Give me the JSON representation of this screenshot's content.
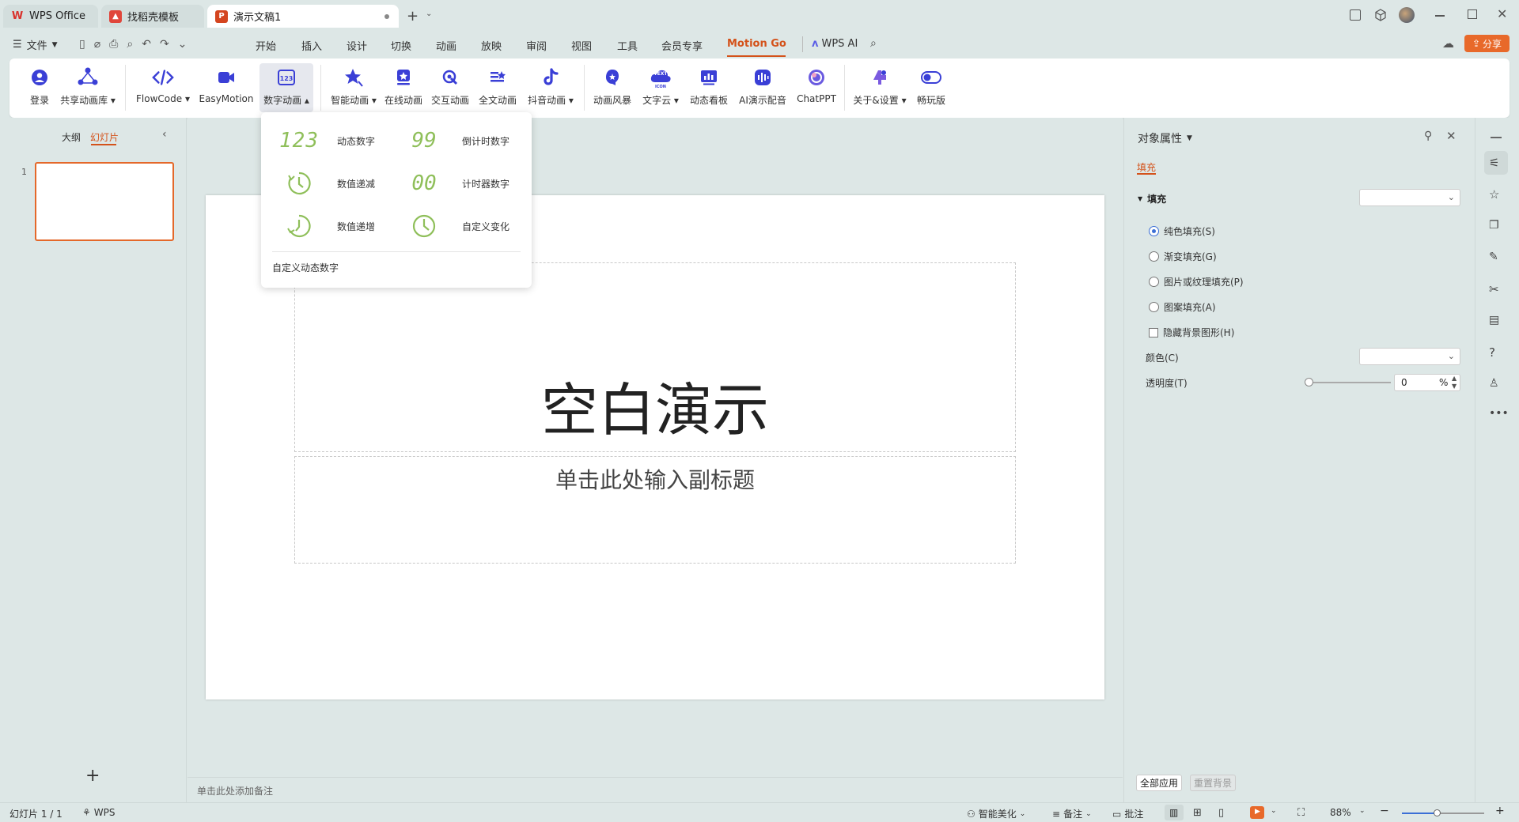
{
  "tabs": [
    {
      "label": "WPS Office",
      "icon": "wps-logo-icon"
    },
    {
      "label": "找稻壳模板",
      "icon": "docer-icon"
    },
    {
      "label": "演示文稿1",
      "icon": "presentation-icon"
    }
  ],
  "menu": {
    "file": "文件",
    "items": [
      "开始",
      "插入",
      "设计",
      "切换",
      "动画",
      "放映",
      "审阅",
      "视图",
      "工具",
      "会员专享",
      "Motion Go"
    ],
    "active": "Motion Go",
    "wps_ai": "WPS AI",
    "share": "分享"
  },
  "ribbon": {
    "buttons": [
      {
        "label": "登录",
        "icon": "user-icon"
      },
      {
        "label": "共享动画库",
        "icon": "share-library-icon",
        "dropdown": true
      },
      {
        "label": "FlowCode",
        "icon": "code-icon",
        "dropdown": true
      },
      {
        "label": "EasyMotion",
        "icon": "video-icon"
      },
      {
        "label": "数字动画",
        "icon": "number-animation-icon",
        "dropdown": true
      },
      {
        "label": "智能动画",
        "icon": "star-icon",
        "dropdown": true
      },
      {
        "label": "在线动画",
        "icon": "online-animation-icon"
      },
      {
        "label": "交互动画",
        "icon": "interactive-icon"
      },
      {
        "label": "全文动画",
        "icon": "fulltext-icon"
      },
      {
        "label": "抖音动画",
        "icon": "tiktok-icon",
        "dropdown": true
      },
      {
        "label": "动画风暴",
        "icon": "storm-icon"
      },
      {
        "label": "文字云",
        "icon": "word-cloud-icon",
        "dropdown": true
      },
      {
        "label": "动态看板",
        "icon": "dashboard-icon"
      },
      {
        "label": "AI演示配音",
        "icon": "voice-icon"
      },
      {
        "label": "ChatPPT",
        "icon": "chatppt-icon"
      },
      {
        "label": "关于&设置",
        "icon": "settings-icon",
        "dropdown": true
      },
      {
        "label": "畅玩版",
        "icon": "toggle-icon"
      }
    ],
    "wordcloud_badge_top": "TEXT",
    "wordcloud_badge_bottom": "ICON"
  },
  "dropdown": {
    "items": [
      {
        "label": "动态数字",
        "glyph": "123"
      },
      {
        "label": "倒计时数字",
        "glyph": "99"
      },
      {
        "label": "数值递减",
        "glyph": ""
      },
      {
        "label": "计时器数字",
        "glyph": "00"
      },
      {
        "label": "数值递增",
        "glyph": ""
      },
      {
        "label": "自定义变化",
        "glyph": ""
      }
    ],
    "custom": "自定义动态数字"
  },
  "leftpanel": {
    "tab_outline": "大纲",
    "tab_slides": "幻灯片",
    "slide_number": "1",
    "add": "+"
  },
  "slide": {
    "title": "空白演示",
    "subtitle": "单击此处输入副标题"
  },
  "notes": {
    "placeholder": "单击此处添加备注"
  },
  "rightpanel": {
    "title": "对象属性",
    "tab": "填充",
    "section": "填充",
    "options": [
      "纯色填充(S)",
      "渐变填充(G)",
      "图片或纹理填充(P)",
      "图案填充(A)"
    ],
    "selected_option": 0,
    "hide_bg": "隐藏背景图形(H)",
    "color_label": "颜色(C)",
    "transparency_label": "透明度(T)",
    "transparency_value": "0",
    "transparency_unit": "%",
    "apply_all": "全部应用",
    "reset_bg": "重置背景"
  },
  "status": {
    "slide_count": "幻灯片 1 / 1",
    "theme": "WPS",
    "beautify": "智能美化",
    "notes": "备注",
    "comments": "批注",
    "zoom": "88%"
  },
  "colors": {
    "accent": "#d4521a",
    "ribbon_icon": "#3a3fd6",
    "dropdown_glyph": "#8fbf5a"
  }
}
